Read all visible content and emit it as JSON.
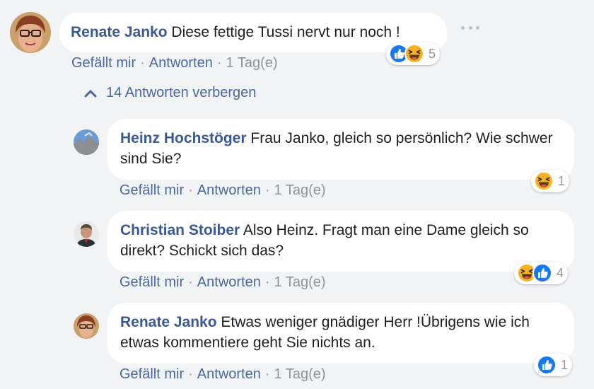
{
  "colors": {
    "link": "#385898",
    "meta": "#90949c",
    "like": "#1877f2",
    "haha": "#f7b125",
    "background": "#f2f3f5"
  },
  "comment": {
    "author": "Renate Janko",
    "text": "Diese fettige Tussi nervt nur noch !",
    "like_label": "Gefällt mir",
    "reply_label": "Antworten",
    "time": "1 Tag(e)",
    "reaction_icons": [
      "like-icon",
      "haha-icon"
    ],
    "reaction_count": "5"
  },
  "toggle_label": "14 Antworten verbergen",
  "replies": [
    {
      "author": "Heinz Hochstöger",
      "text": "Frau Janko, gleich so persönlich? Wie schwer sind Sie?",
      "like_label": "Gefällt mir",
      "reply_label": "Antworten",
      "time": "1 Tag(e)",
      "reaction_icons": [
        "haha-icon"
      ],
      "reaction_count": "1"
    },
    {
      "author": "Christian Stoiber",
      "text": "Also Heinz. Fragt man eine Dame gleich so direkt? Schickt sich das?",
      "like_label": "Gefällt mir",
      "reply_label": "Antworten",
      "time": "1 Tag(e)",
      "reaction_icons": [
        "haha-icon",
        "like-icon"
      ],
      "reaction_count": "4"
    },
    {
      "author": "Renate Janko",
      "text": "Etwas weniger gnädiger Herr !Übrigens wie ich etwas kommentiere geht Sie nichts an.",
      "like_label": "Gefällt mir",
      "reply_label": "Antworten",
      "time": "1 Tag(e)",
      "reaction_icons": [
        "like-icon"
      ],
      "reaction_count": "1"
    }
  ]
}
